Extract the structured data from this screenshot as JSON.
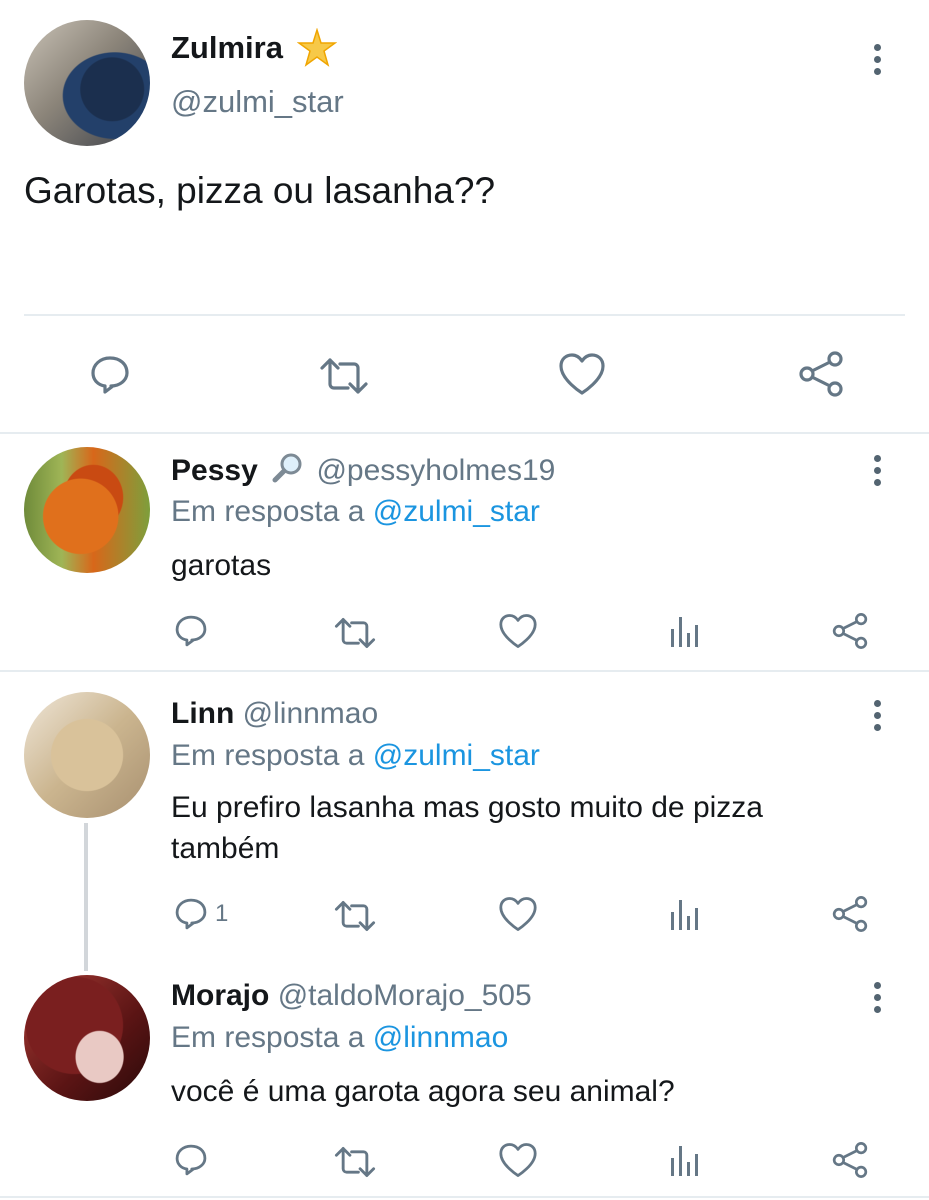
{
  "main_tweet": {
    "author_name": "Zulmira",
    "author_badge": "star-icon",
    "author_handle": "@zulmi_star",
    "text": "Garotas, pizza ou lasanha??"
  },
  "replies": [
    {
      "author_name": "Pessy",
      "author_badge": "magnifier-icon",
      "author_handle": "@pessyholmes19",
      "reply_prefix": "Em resposta a",
      "reply_to": "@zulmi_star",
      "text": "garotas",
      "reply_count": ""
    },
    {
      "author_name": "Linn",
      "author_handle": "@linnmao",
      "reply_prefix": "Em resposta a",
      "reply_to": "@zulmi_star",
      "text": "Eu prefiro lasanha mas gosto muito de pizza também",
      "reply_count": "1"
    },
    {
      "author_name": "Morajo",
      "author_handle": "@taldoMorajo_505",
      "reply_prefix": "Em resposta a",
      "reply_to": "@linnmao",
      "text": "você é uma garota agora seu animal?",
      "reply_count": ""
    }
  ],
  "colors": {
    "text": "#14171a",
    "muted": "#657786",
    "link": "#1b95e0",
    "icon": "#657786",
    "divider": "#e6ecf0"
  }
}
